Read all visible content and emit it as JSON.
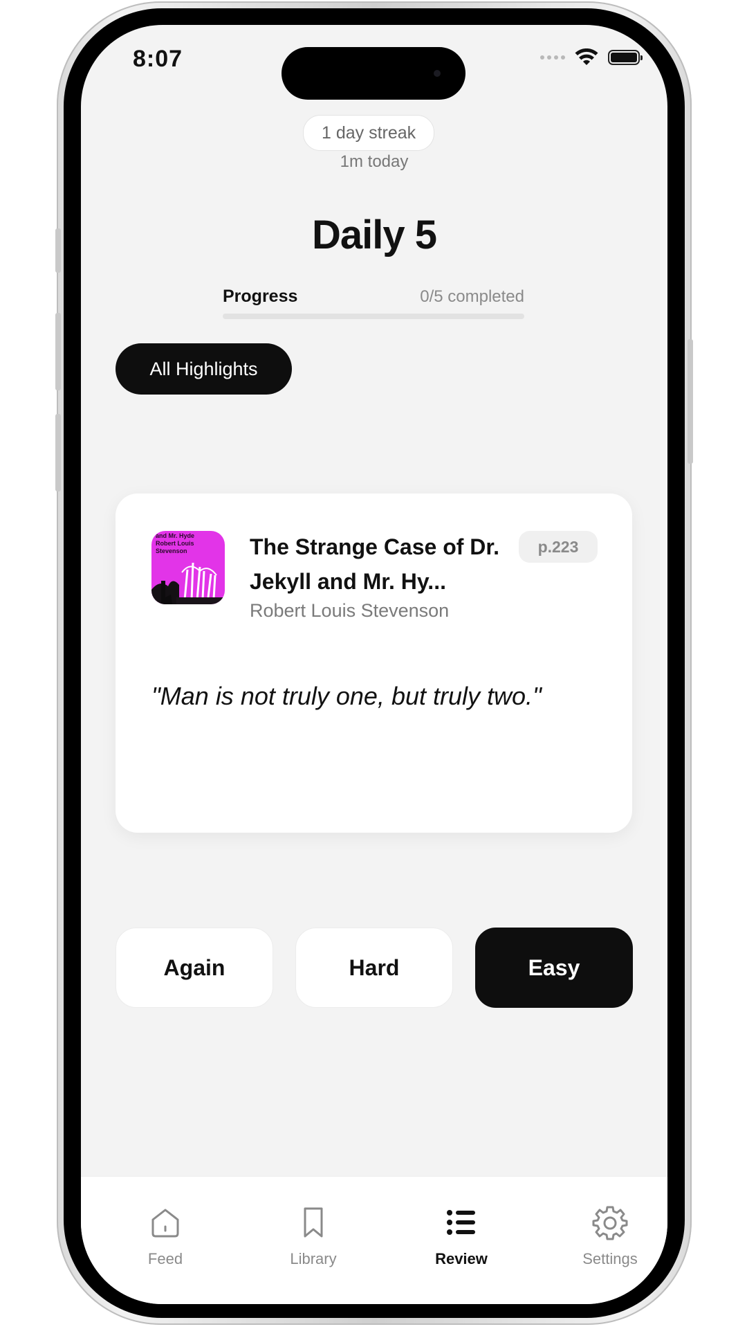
{
  "status_bar": {
    "time": "8:07"
  },
  "header": {
    "streak": "1 day streak",
    "today": "1m today",
    "title": "Daily 5"
  },
  "progress": {
    "label": "Progress",
    "count_text": "0/5 completed",
    "fraction": 0
  },
  "filter": {
    "label": "All Highlights"
  },
  "card": {
    "cover_text": "and Mr. Hyde\nRobert Louis\nStevenson",
    "cover_color": "#e234e8",
    "title": "The Strange Case of Dr. Jekyll and Mr. Hy...",
    "author": "Robert Louis Stevenson",
    "page": "p.223",
    "quote": "\"Man is not truly one, but truly two.\""
  },
  "actions": {
    "again": "Again",
    "hard": "Hard",
    "easy": "Easy"
  },
  "tabs": [
    {
      "label": "Feed",
      "icon": "home-icon"
    },
    {
      "label": "Library",
      "icon": "bookmark-icon"
    },
    {
      "label": "Review",
      "icon": "list-icon",
      "active": true
    },
    {
      "label": "Settings",
      "icon": "gear-icon"
    }
  ],
  "colors": {
    "primary": "#0e0e0e",
    "background": "#f3f3f3",
    "muted": "#8a8a8a"
  }
}
